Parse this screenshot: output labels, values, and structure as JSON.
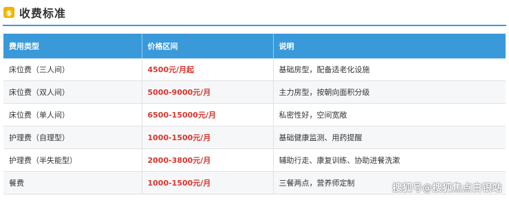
{
  "header": {
    "title": "收费标准",
    "icon": "money-bag-icon"
  },
  "table": {
    "columns": [
      "费用类型",
      "价格区间",
      "说明"
    ],
    "rows": [
      {
        "type": "床位费（三人间）",
        "price": "4500元/月起",
        "note": "基础房型，配备适老化设施"
      },
      {
        "type": "床位费（双人间）",
        "price": "5000-9000元/月",
        "note": "主力房型，按朝向面积分级"
      },
      {
        "type": "床位费（单人间）",
        "price": "6500-15000元/月",
        "note": "私密性好，空间宽敞"
      },
      {
        "type": "护理费（自理型）",
        "price": "1000-1500元/月",
        "note": "基础健康监测、用药提醒"
      },
      {
        "type": "护理费（半失能型）",
        "price": "2000-3800元/月",
        "note": "辅助行走、康复训练、协助进餐洗漱"
      },
      {
        "type": "餐费",
        "price": "1000-1500元/月",
        "note": "三餐两点，营养师定制"
      }
    ]
  },
  "watermark": "搜狐号@搜狐焦点白银站",
  "colors": {
    "accent": "#3a9ad9",
    "price": "#d9342b",
    "icon_bg": "#f0b400"
  }
}
